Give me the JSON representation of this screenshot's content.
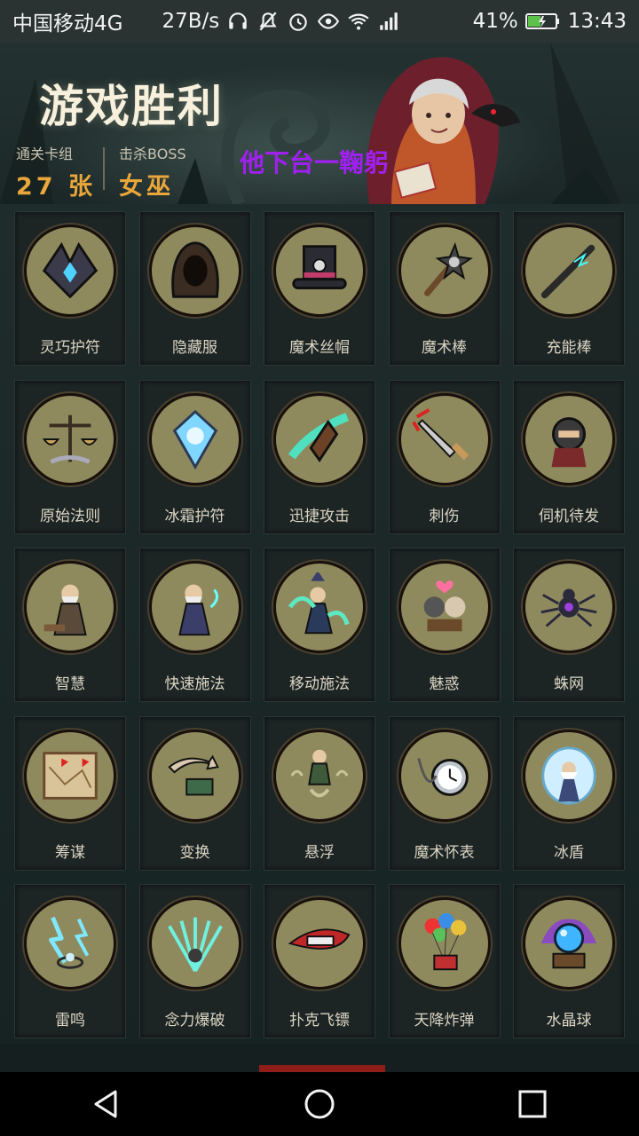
{
  "status_bar": {
    "carrier": "中国移动4G",
    "speed": "27B/s",
    "battery_percent": "41%",
    "time": "13:43",
    "signal_type": "4G",
    "icons": [
      "headphones-icon",
      "mute-icon",
      "alarm-icon",
      "eye-icon",
      "wifi-icon",
      "signal-icon",
      "battery-icon"
    ]
  },
  "header": {
    "title": "游戏胜利",
    "cards_label": "通关卡组",
    "cards_value": "27 张",
    "boss_label": "击杀BOSS",
    "boss_value": "女巫",
    "overlay_text": "他下台一鞠躬"
  },
  "cards": [
    {
      "label": "灵巧护符",
      "icon": "amulet-icon"
    },
    {
      "label": "隐藏服",
      "icon": "hood-icon"
    },
    {
      "label": "魔术丝帽",
      "icon": "top-hat-icon"
    },
    {
      "label": "魔术棒",
      "icon": "magic-wand-icon"
    },
    {
      "label": "充能棒",
      "icon": "charge-rod-icon"
    },
    {
      "label": "原始法则",
      "icon": "scales-icon"
    },
    {
      "label": "冰霜护符",
      "icon": "frost-amulet-icon"
    },
    {
      "label": "迅捷攻击",
      "icon": "swift-attack-icon"
    },
    {
      "label": "刺伤",
      "icon": "dagger-icon"
    },
    {
      "label": "伺机待发",
      "icon": "ninja-icon"
    },
    {
      "label": "智慧",
      "icon": "sage-icon"
    },
    {
      "label": "快速施法",
      "icon": "wizard-icon"
    },
    {
      "label": "移动施法",
      "icon": "casting-wizard-icon"
    },
    {
      "label": "魅惑",
      "icon": "charm-icon"
    },
    {
      "label": "蛛网",
      "icon": "spider-icon"
    },
    {
      "label": "筹谋",
      "icon": "map-icon"
    },
    {
      "label": "变换",
      "icon": "swap-icon"
    },
    {
      "label": "悬浮",
      "icon": "levitate-icon"
    },
    {
      "label": "魔术怀表",
      "icon": "pocket-watch-icon"
    },
    {
      "label": "冰盾",
      "icon": "ice-shield-icon"
    },
    {
      "label": "雷鸣",
      "icon": "thunder-icon"
    },
    {
      "label": "念力爆破",
      "icon": "psychic-blast-icon"
    },
    {
      "label": "扑克飞镖",
      "icon": "card-dart-icon"
    },
    {
      "label": "天降炸弹",
      "icon": "balloon-bomb-icon"
    },
    {
      "label": "水晶球",
      "icon": "crystal-ball-icon"
    }
  ],
  "colors": {
    "accent": "#e9a63a",
    "medal": "#8f8a5e",
    "overlay_text": "#a020f0",
    "background": "#1a2526"
  },
  "navbar": {
    "icons": [
      "back-icon",
      "home-icon",
      "recents-icon"
    ]
  }
}
